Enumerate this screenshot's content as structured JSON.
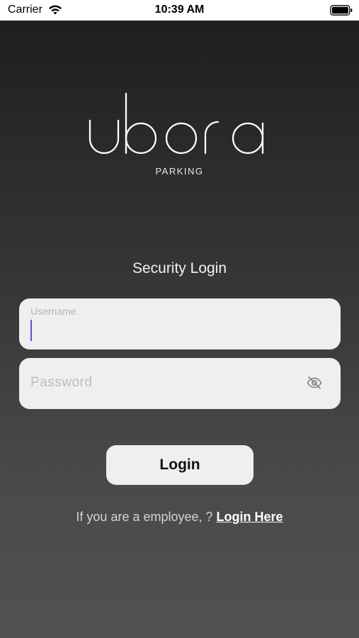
{
  "status_bar": {
    "carrier": "Carrier",
    "time": "10:39 AM",
    "icons": [
      "wifi-icon",
      "battery-icon"
    ]
  },
  "brand": {
    "logo_text": "ubora",
    "subtitle": "PARKING"
  },
  "form": {
    "title": "Security Login",
    "username": {
      "label": "Username",
      "value": ""
    },
    "password": {
      "placeholder": "Password",
      "value": "",
      "toggle_icon": "eye-off-icon"
    },
    "submit_label": "Login"
  },
  "footer": {
    "prompt": "If you are a employee, ? ",
    "link_label": "Login Here"
  },
  "colors": {
    "field_bg": "#efefef",
    "caret": "#6a4fc9",
    "text_light": "#f2f2f2"
  }
}
